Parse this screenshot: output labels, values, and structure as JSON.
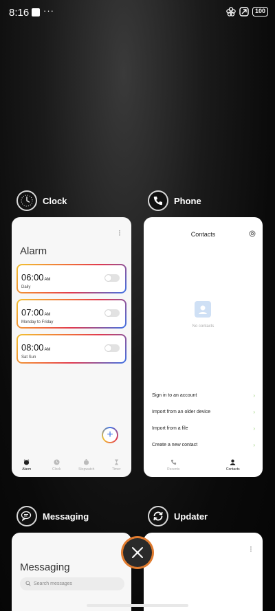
{
  "status_bar": {
    "time": "8:16",
    "more": "···",
    "battery": "100"
  },
  "recents": {
    "clock": {
      "app_name": "Clock",
      "screen_title": "Alarm",
      "alarms": [
        {
          "time": "06:00",
          "ampm": "AM",
          "repeat": "Daily"
        },
        {
          "time": "07:00",
          "ampm": "AM",
          "repeat": "Monday to Friday"
        },
        {
          "time": "08:00",
          "ampm": "AM",
          "repeat": "Sat Sun"
        }
      ],
      "tabs": [
        "Alarm",
        "Clock",
        "Stopwatch",
        "Timer"
      ]
    },
    "phone": {
      "app_name": "Phone",
      "screen_title": "Contacts",
      "empty_text": "No contacts",
      "options": [
        "Sign in to an account",
        "Import from an older device",
        "Import from a file",
        "Create a new contact"
      ],
      "tabs": [
        "Recents",
        "Contacts"
      ]
    },
    "messaging": {
      "app_name": "Messaging",
      "screen_title": "Messaging",
      "search_placeholder": "Search messages"
    },
    "updater": {
      "app_name": "Updater"
    }
  },
  "colors": {
    "close_ring": "#e07b2f",
    "accent_blue": "#3d73e8"
  }
}
